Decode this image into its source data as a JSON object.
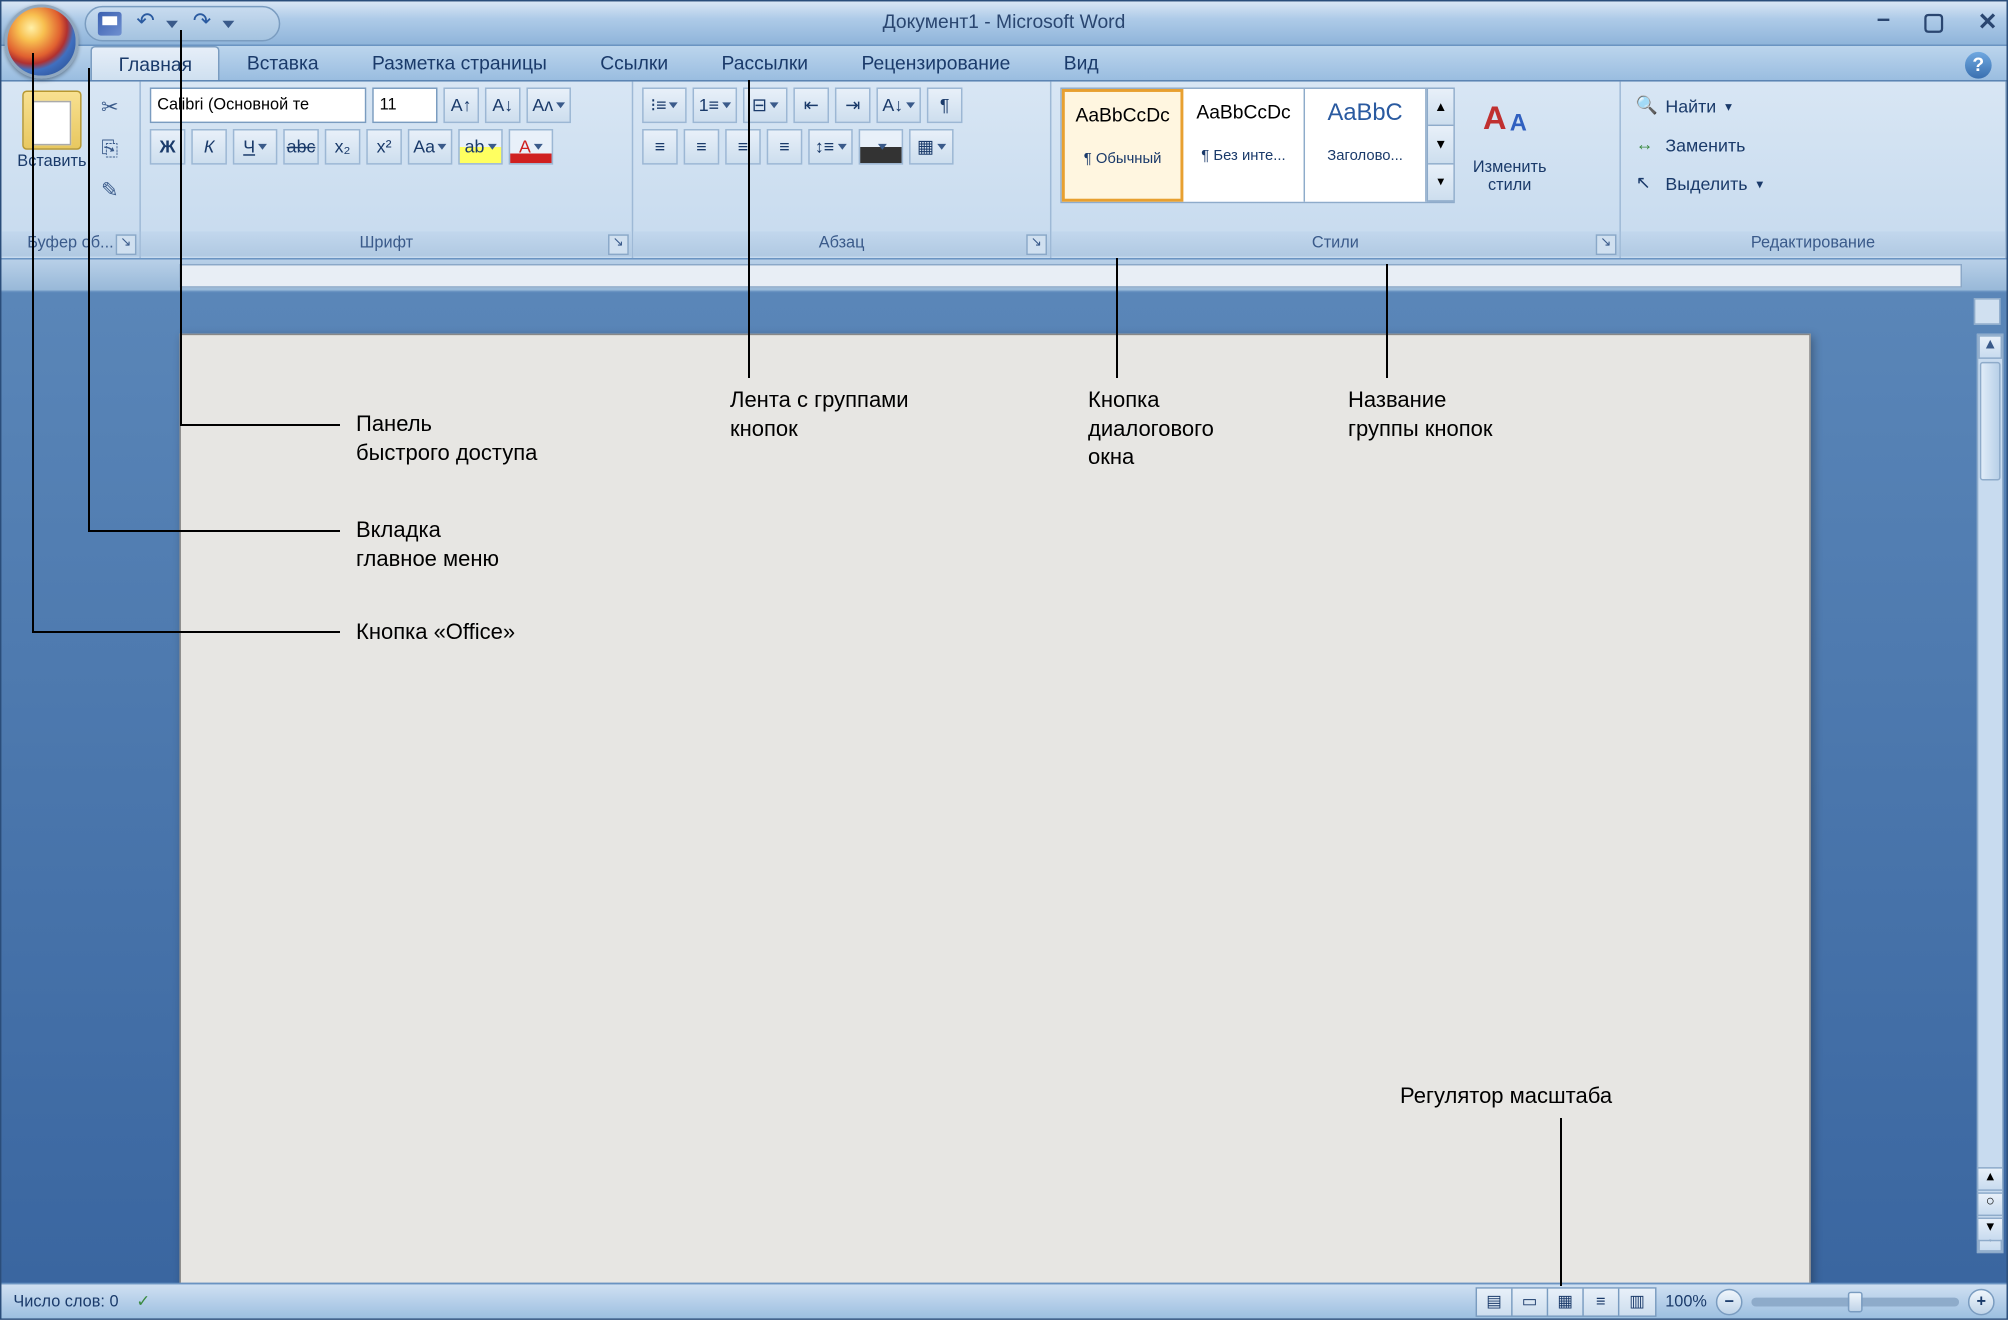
{
  "title": "Документ1 - Microsoft Word",
  "tabs": [
    "Главная",
    "Вставка",
    "Разметка страницы",
    "Ссылки",
    "Рассылки",
    "Рецензирование",
    "Вид"
  ],
  "active_tab": 0,
  "ribbon": {
    "clipboard": {
      "paste": "Вставить",
      "label": "Буфер об...",
      "cut": "cut-icon",
      "copy": "copy-icon",
      "painter": "format-painter-icon"
    },
    "font": {
      "name": "Calibri (Основной те",
      "size": "11",
      "label": "Шрифт",
      "buttons_row1": [
        "A↑",
        "A↓",
        "Aa"
      ],
      "bold": "Ж",
      "italic": "К",
      "underline": "Ч",
      "strike": "abc",
      "sub": "x₂",
      "sup": "x²",
      "case": "Aa"
    },
    "paragraph": {
      "label": "Абзац"
    },
    "styles": {
      "label": "Стили",
      "items": [
        {
          "preview": "AaBbCcDc",
          "name": "¶ Обычный"
        },
        {
          "preview": "AaBbCcDc",
          "name": "¶ Без инте..."
        },
        {
          "preview": "AaBbC",
          "name": "Заголово..."
        }
      ],
      "change": "Изменить стили"
    },
    "editing": {
      "label": "Редактирование",
      "find": "Найти",
      "replace": "Заменить",
      "select": "Выделить"
    }
  },
  "status": {
    "words": "Число слов: 0",
    "zoom": "100%"
  },
  "annotations": {
    "qat": "Панель\nбыстрого доступа",
    "tab": "Вкладка\nглавное меню",
    "office": "Кнопка «Office»",
    "ribbon": "Лента с группами\nкнопок",
    "dialog": "Кнопка\nдиалогового\nокна",
    "groupname": "Название\nгруппы кнопок",
    "zoom": "Регулятор масштаба"
  }
}
